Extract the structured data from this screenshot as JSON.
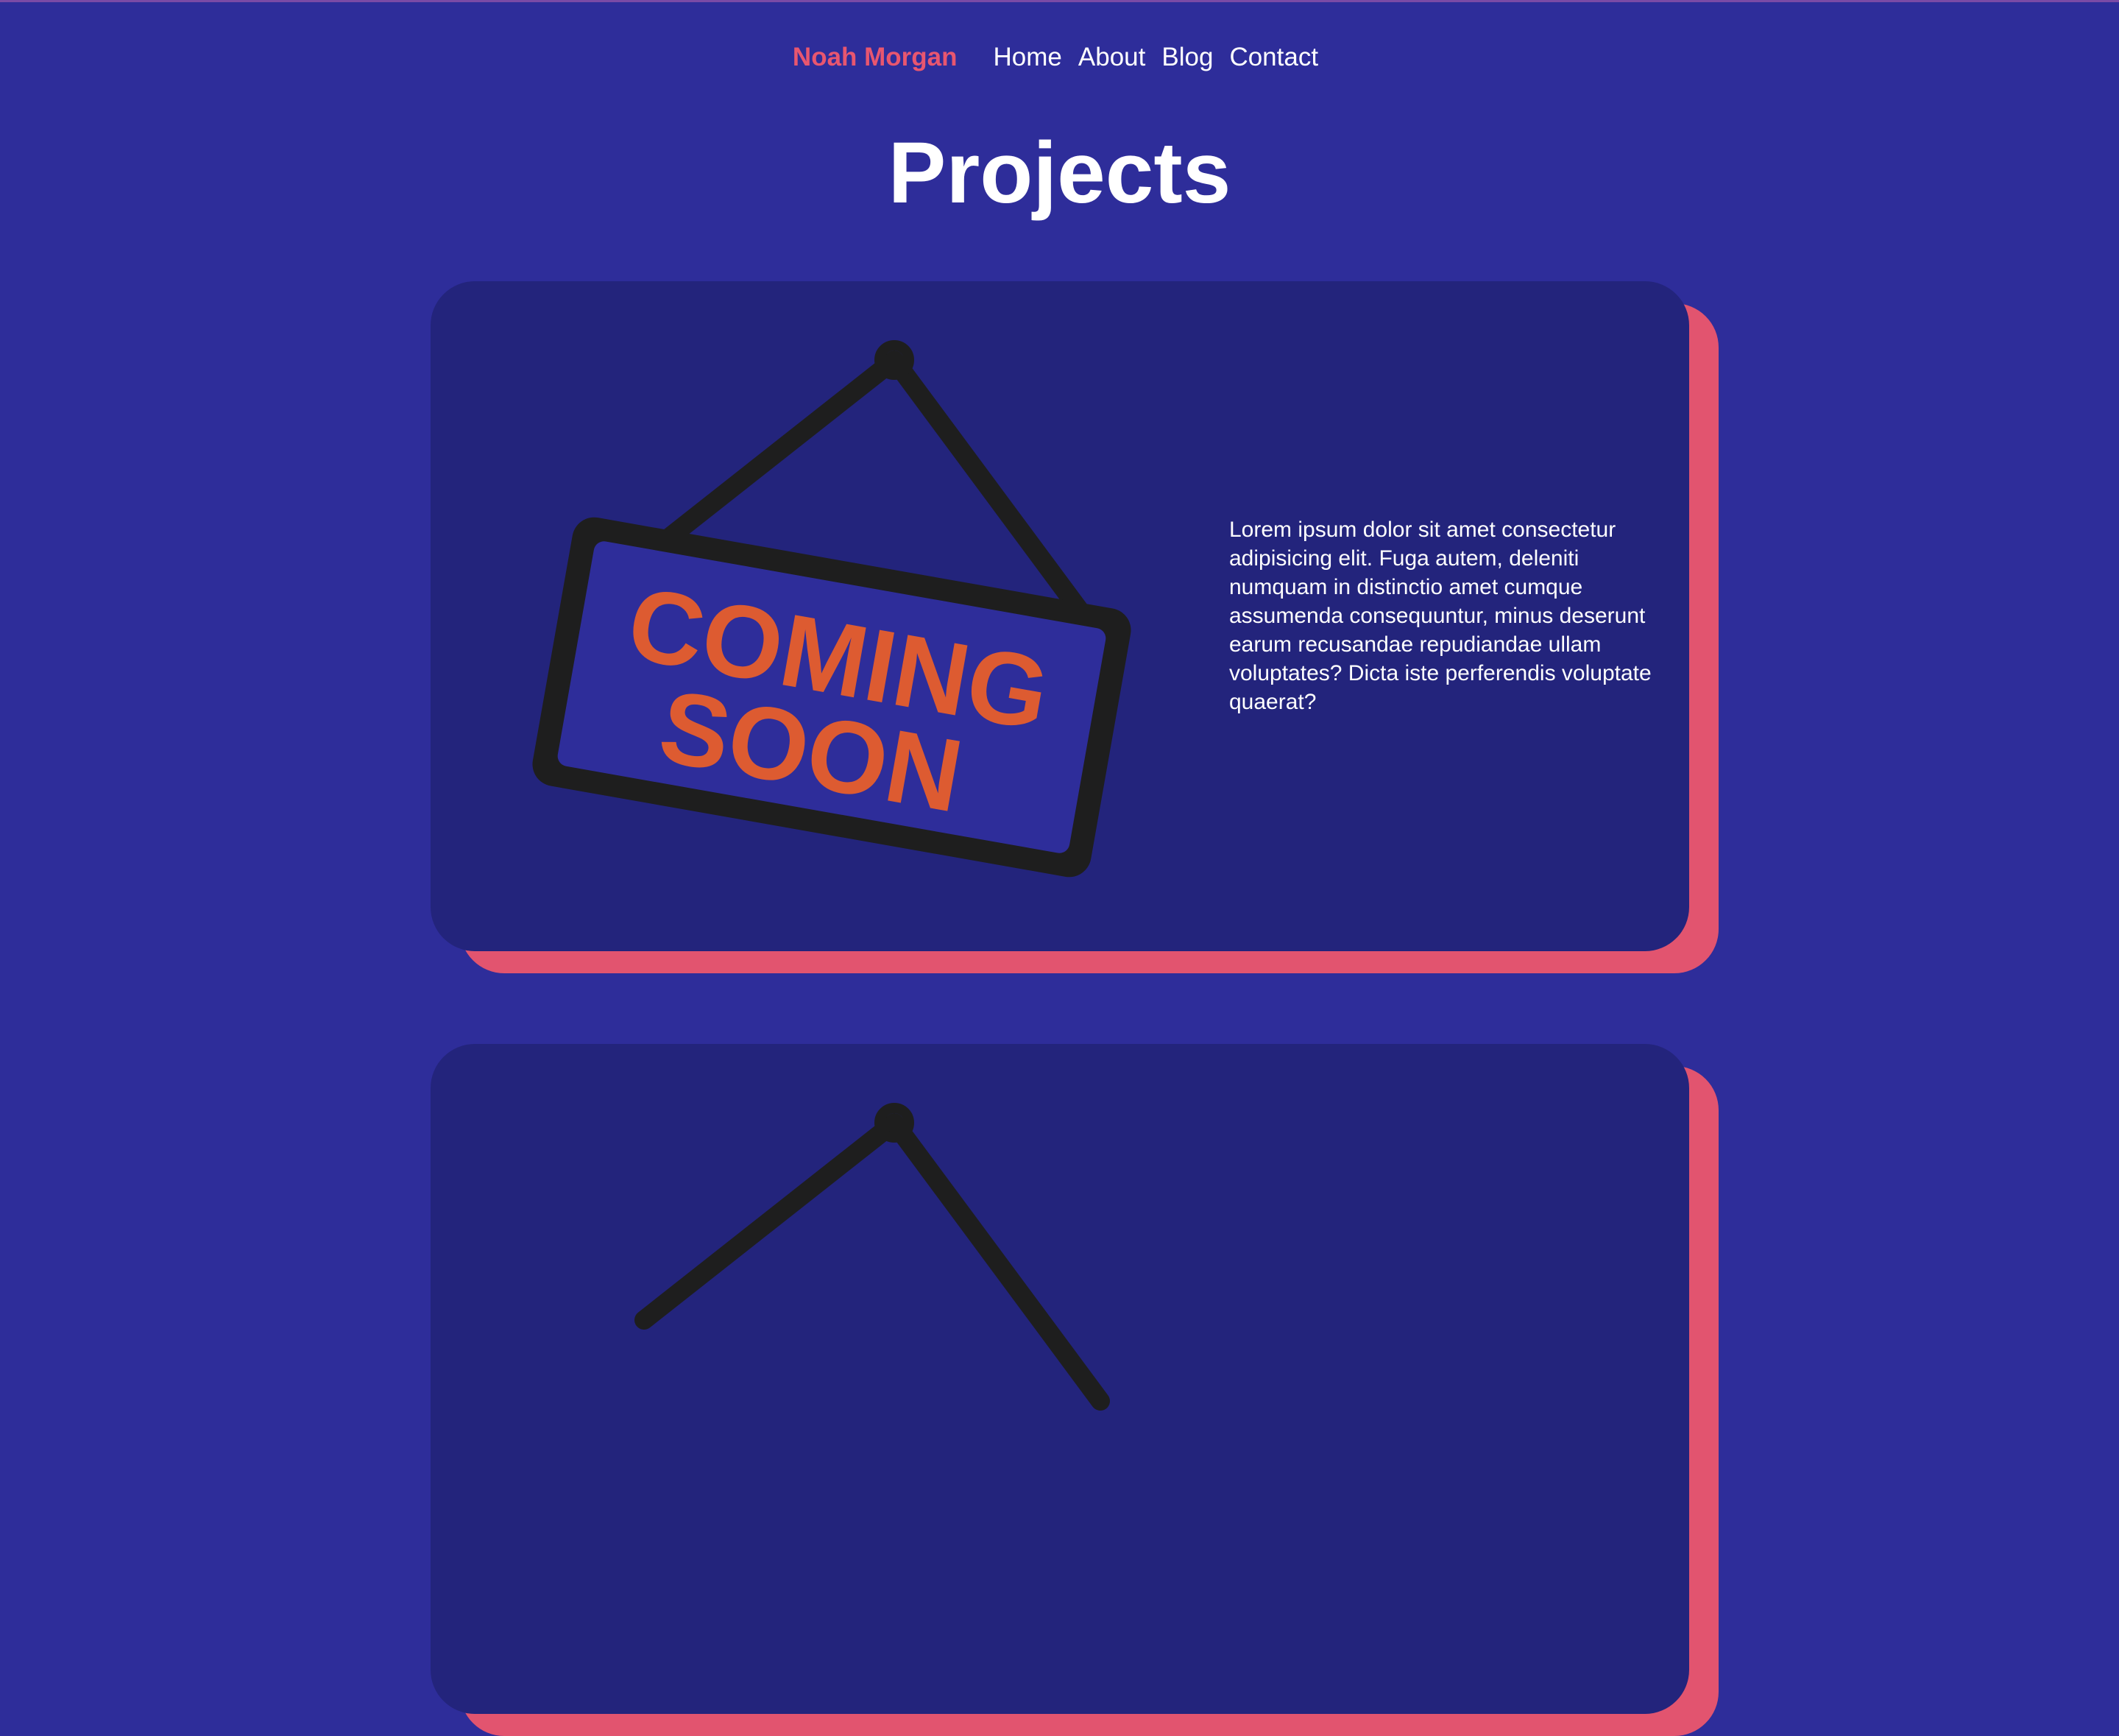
{
  "nav": {
    "brand": "Noah Morgan",
    "links": [
      "Home",
      "About",
      "Blog",
      "Contact"
    ]
  },
  "page": {
    "title": "Projects"
  },
  "projects": [
    {
      "image_icon": "coming-soon-sign-icon",
      "image_text_line1": "COMING",
      "image_text_line2": "SOON",
      "description": "Lorem ipsum dolor sit amet consectetur adipisicing elit. Fuga autem, deleniti numquam in distinctio amet cumque assumenda consequuntur, minus deserunt earum recusandae repudiandae ullam voluptates? Dicta iste perferendis voluptate quaerat?"
    },
    {
      "image_icon": "coming-soon-sign-icon"
    }
  ],
  "colors": {
    "background": "#2e2d9a",
    "card": "#23247c",
    "card_shadow": "#e2546f",
    "brand": "#e8566f",
    "sign_text": "#dd5b31",
    "sign_frame": "#1e1e1e"
  }
}
